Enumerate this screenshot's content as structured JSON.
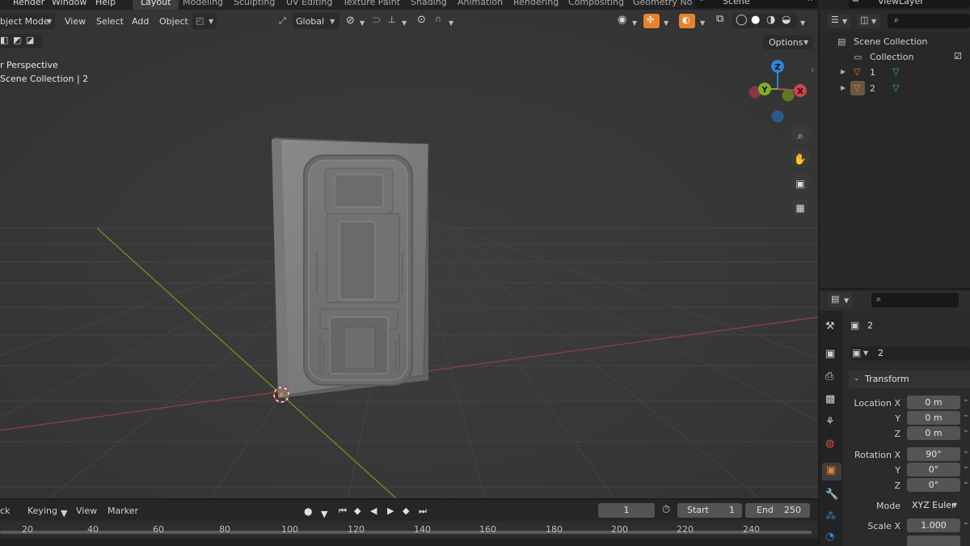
{
  "menu": {
    "items": [
      "Render",
      "Window",
      "Help"
    ],
    "workspaces": [
      "Layout",
      "Modeling",
      "Sculpting",
      "UV Editing",
      "Texture Paint",
      "Shading",
      "Animation",
      "Rendering",
      "Compositing",
      "Geometry No"
    ],
    "active_workspace": "Layout",
    "scene": "Scene",
    "view_layer": "ViewLayer"
  },
  "viewport_header": {
    "mode": "bject Mode",
    "menus": [
      "View",
      "Select",
      "Add",
      "Object"
    ],
    "transform_orientation": "Global",
    "options": "Options"
  },
  "viewport_overlay": {
    "view_name": "r Perspective",
    "collection_info": "Scene Collection | 2"
  },
  "gizmo": {
    "z": "Z",
    "y": "Y",
    "x": "X"
  },
  "outliner": {
    "root": "Scene Collection",
    "collection": "Collection",
    "objects": [
      "1",
      "2"
    ]
  },
  "properties": {
    "object_name": "2",
    "object_field": "2",
    "panel": "Transform",
    "location": {
      "label_x": "Location X",
      "x": "0 m",
      "y": "0 m",
      "z": "0 m"
    },
    "rotation": {
      "label_x": "Rotation X",
      "x": "90°",
      "y": "0°",
      "z": "0°"
    },
    "axis_y": "Y",
    "axis_z": "Z",
    "mode_label": "Mode",
    "mode_value": "XYZ Euler",
    "scale": {
      "label_x": "Scale X",
      "x": "1.000"
    }
  },
  "timeline": {
    "menus": [
      "ck",
      "Keying",
      "View",
      "Marker"
    ],
    "current_frame": "1",
    "start_label": "Start",
    "start": "1",
    "end_label": "End",
    "end": "250",
    "ruler": [
      "20",
      "40",
      "60",
      "80",
      "100",
      "120",
      "140",
      "160",
      "180",
      "200",
      "220",
      "240"
    ]
  },
  "colors": {
    "accent_orange": "#e6832d",
    "axis_red": "#d2414f",
    "axis_green": "#7fb022",
    "axis_blue": "#2f83d4",
    "viewport_bg": "#393939"
  }
}
